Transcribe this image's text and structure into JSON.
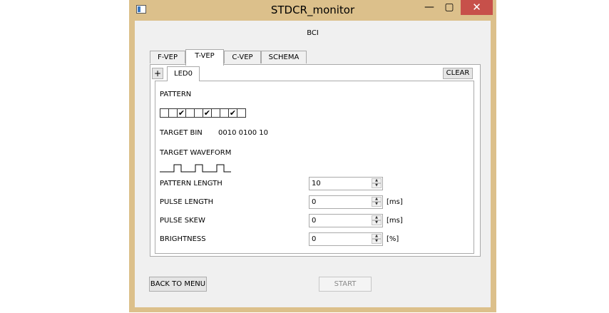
{
  "window": {
    "title": "STDCR_monitor",
    "min_glyph": "—",
    "max_glyph": "▢",
    "close_glyph": "✕"
  },
  "header": {
    "label": "BCI"
  },
  "tabs": [
    {
      "label": "F-VEP",
      "active": false
    },
    {
      "label": "T-VEP",
      "active": true
    },
    {
      "label": "C-VEP",
      "active": false
    },
    {
      "label": "SCHEMA",
      "active": false
    }
  ],
  "subtabs": {
    "add_label": "+",
    "active_label": "LED0",
    "clear_label": "CLEAR"
  },
  "pattern": {
    "label": "PATTERN",
    "checkboxes": [
      false,
      false,
      true,
      false,
      false,
      true,
      false,
      false,
      true,
      false
    ]
  },
  "target_bin": {
    "label": "TARGET BIN",
    "value": "0010 0100 10"
  },
  "target_waveform": {
    "label": "TARGET WAVEFORM"
  },
  "fields": {
    "pattern_length": {
      "label": "PATTERN LENGTH",
      "value": "10",
      "unit": ""
    },
    "pulse_length": {
      "label": "PULSE LENGTH",
      "value": "0",
      "unit": "[ms]"
    },
    "pulse_skew": {
      "label": "PULSE SKEW",
      "value": "0",
      "unit": "[ms]"
    },
    "brightness": {
      "label": "BRIGHTNESS",
      "value": "0",
      "unit": "[%]"
    }
  },
  "spin_up_glyph": "▲",
  "spin_down_glyph": "▼",
  "check_glyph": "✔",
  "buttons": {
    "back_label": "BACK TO MENU",
    "start_label": "START"
  },
  "colors": {
    "frame": "#dcc08b",
    "close_button": "#c7504a",
    "client_bg": "#f0f0f0"
  }
}
